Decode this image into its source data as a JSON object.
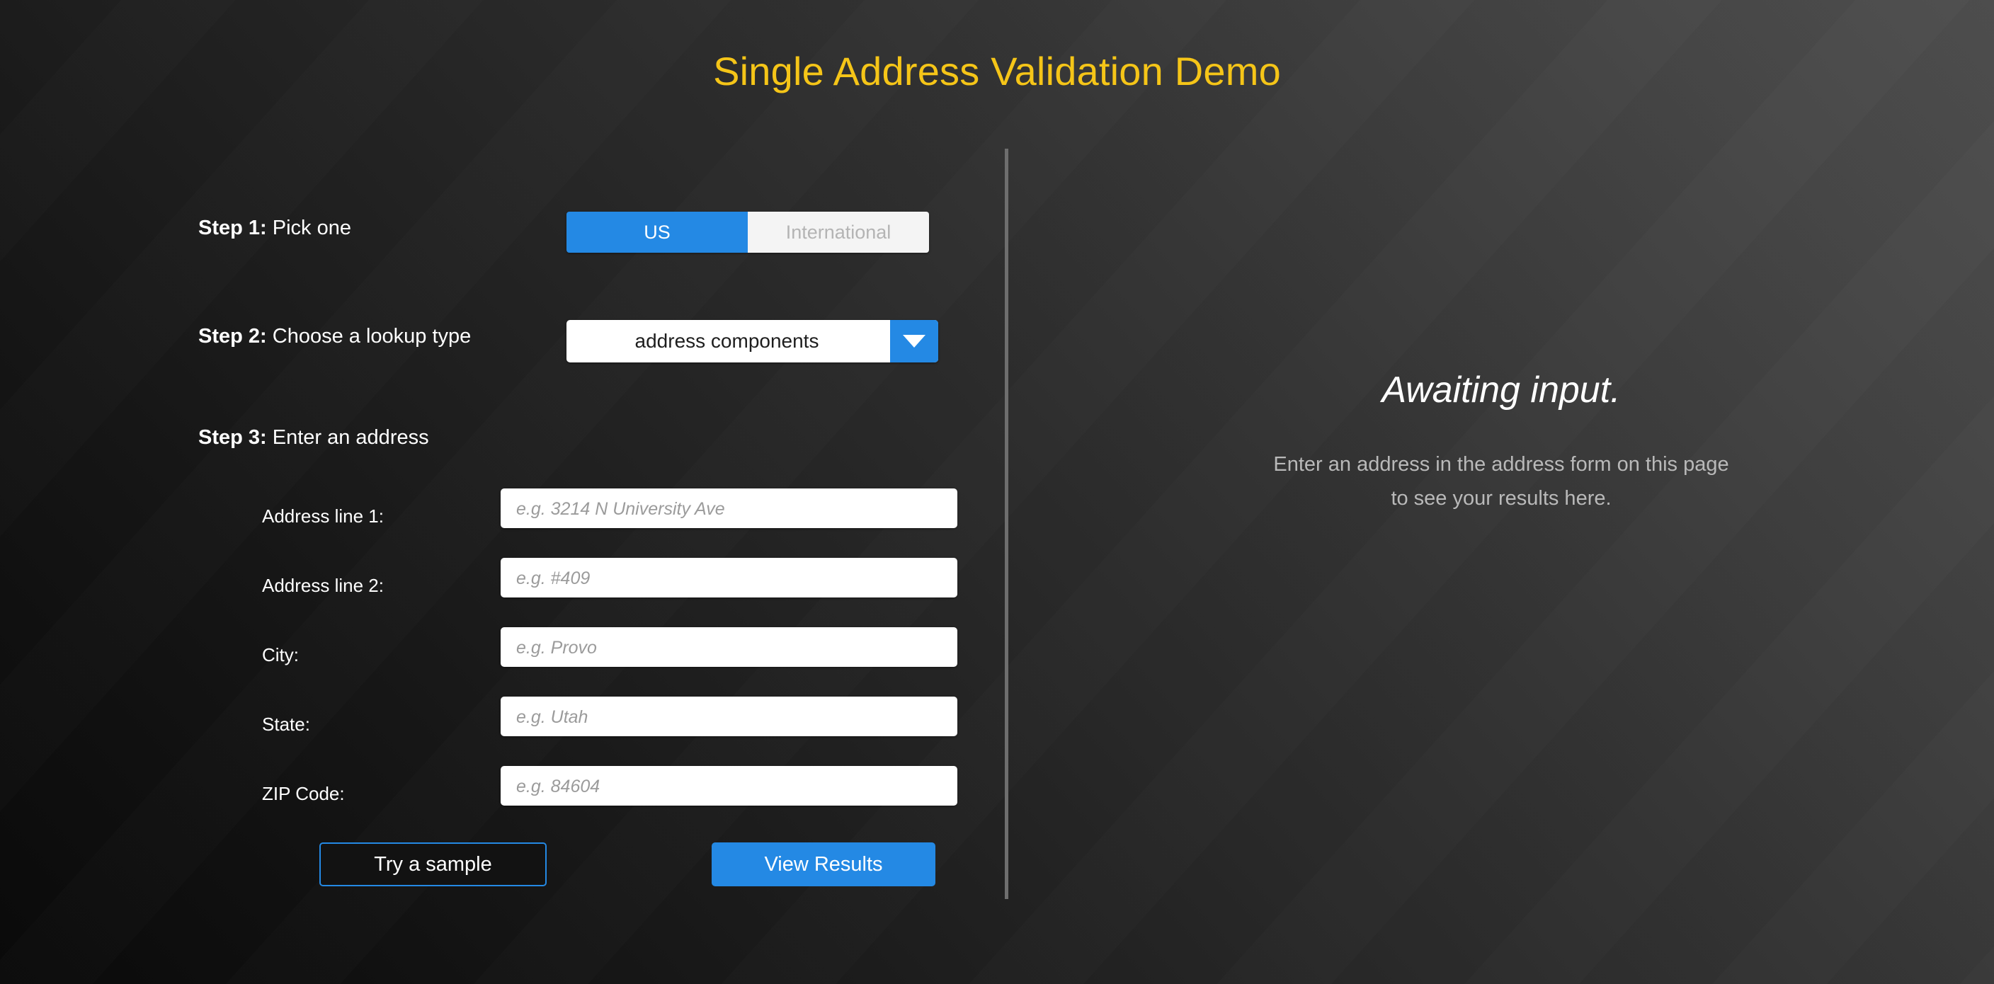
{
  "page": {
    "title": "Single Address Validation Demo",
    "accent_blue": "#2489e4",
    "title_gold": "#f5c518"
  },
  "steps": {
    "step1": {
      "number": "Step 1:",
      "text": " Pick one"
    },
    "step2": {
      "number": "Step 2:",
      "text": " Choose a lookup type"
    },
    "step3": {
      "number": "Step 3:",
      "text": " Enter an address"
    }
  },
  "country_toggle": {
    "options": [
      "US",
      "International"
    ],
    "selected": "US",
    "us_label": "US",
    "international_label": "International"
  },
  "lookup_type": {
    "selected": "address components",
    "arrow_icon": "chevron-down-icon"
  },
  "address_form": {
    "fields": [
      {
        "label": "Address line 1:",
        "value": "",
        "placeholder": "e.g. 3214 N University Ave",
        "name": "address-line-1"
      },
      {
        "label": "Address line 2:",
        "value": "",
        "placeholder": "e.g. #409",
        "name": "address-line-2"
      },
      {
        "label": "City:",
        "value": "",
        "placeholder": "e.g. Provo",
        "name": "city"
      },
      {
        "label": "State:",
        "value": "",
        "placeholder": "e.g. Utah",
        "name": "state"
      },
      {
        "label": "ZIP Code:",
        "value": "",
        "placeholder": "e.g. 84604",
        "name": "zip-code"
      }
    ]
  },
  "actions": {
    "try_sample_label": "Try a sample",
    "view_results_label": "View Results"
  },
  "results_panel": {
    "heading": "Awaiting input.",
    "subtext_line1": "Enter an address in the address form on this page",
    "subtext_line2": "to see your results here."
  }
}
